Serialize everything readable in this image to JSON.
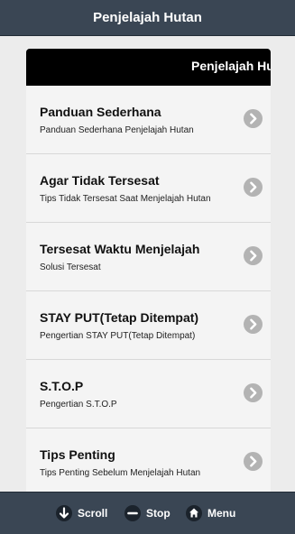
{
  "header": {
    "title": "Penjelajah Hutan"
  },
  "content_header": {
    "title": "Penjelajah Hutan"
  },
  "items": [
    {
      "title": "Panduan Sederhana",
      "subtitle": "Panduan Sederhana Penjelajah Hutan"
    },
    {
      "title": "Agar Tidak Tersesat",
      "subtitle": "Tips Tidak Tersesat Saat Menjelajah Hutan"
    },
    {
      "title": "Tersesat Waktu Menjelajah",
      "subtitle": "Solusi Tersesat"
    },
    {
      "title": "STAY PUT(Tetap Ditempat)",
      "subtitle": "Pengertian STAY PUT(Tetap Ditempat)"
    },
    {
      "title": "S.T.O.P",
      "subtitle": "Pengertian S.T.O.P"
    },
    {
      "title": "Tips Penting",
      "subtitle": "Tips Penting Sebelum Menjelajah Hutan"
    }
  ],
  "navbar": {
    "scroll_label": "Scroll",
    "stop_label": "Stop",
    "menu_label": "Menu",
    "scroll_icon": "arrow-down-icon",
    "stop_icon": "minus-icon",
    "menu_icon": "home-icon"
  },
  "colors": {
    "bar": "#3a4654",
    "content_header": "#000000",
    "chevron": "#b3b3b3",
    "background": "#ececec"
  }
}
